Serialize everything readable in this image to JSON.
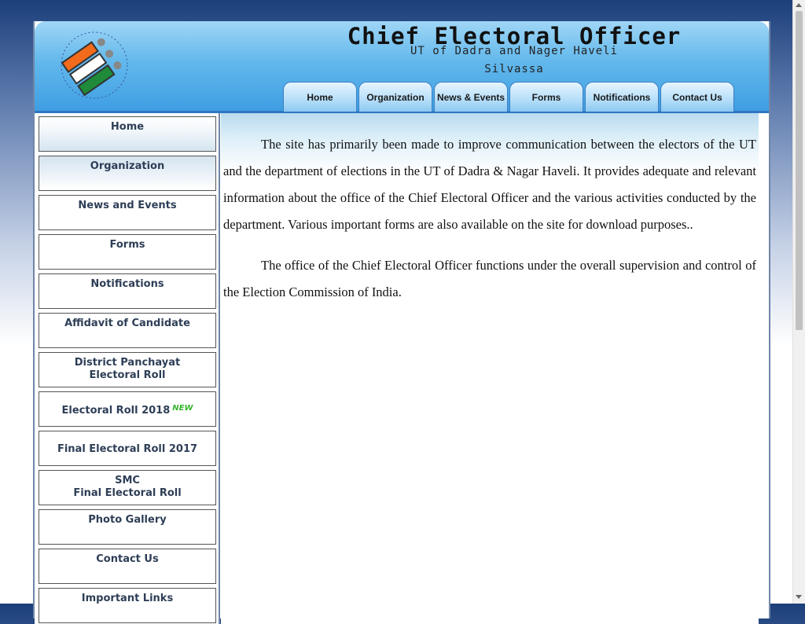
{
  "header": {
    "title": "Chief Electoral Officer",
    "subtitle": "UT of Dadra and Nager Haveli",
    "location": "Silvassa",
    "logo_icon": "ballot-finger-logo"
  },
  "top_nav": [
    {
      "label": "Home"
    },
    {
      "label": "Organization"
    },
    {
      "label": "News & Events"
    },
    {
      "label": "Forms"
    },
    {
      "label": "Notifications"
    },
    {
      "label": "Contact Us"
    }
  ],
  "sidebar": [
    {
      "label": "Home",
      "label2": ""
    },
    {
      "label": "Organization",
      "label2": ""
    },
    {
      "label": "News and Events",
      "label2": ""
    },
    {
      "label": "Forms",
      "label2": ""
    },
    {
      "label": "Notifications",
      "label2": ""
    },
    {
      "label": "Affidavit of Candidate",
      "label2": ""
    },
    {
      "label": "District Panchayat",
      "label2": "Electoral Roll"
    },
    {
      "label": "Electoral Roll 2018",
      "label2": "",
      "badge": "NEW"
    },
    {
      "label": "Final Electoral Roll 2017",
      "label2": ""
    },
    {
      "label": "SMC",
      "label2": "Final Electoral Roll"
    },
    {
      "label": "Photo Gallery",
      "label2": ""
    },
    {
      "label": "Contact Us",
      "label2": ""
    },
    {
      "label": "Important Links",
      "label2": ""
    }
  ],
  "content": {
    "paragraph1": "The site has primarily been made to improve communication between the electors of the UT and the department of elections in the UT of Dadra & Nagar Haveli. It provides adequate and relevant information about the office of the Chief Electoral Officer and the various activities conducted by the department. Various important forms are also available on the site for download purposes..",
    "paragraph2": "The office of the Chief Electoral Officer functions under the overall supervision and control of the Election Commission of India."
  },
  "colors": {
    "header_blue": "#3f9ee2",
    "sidebar_text": "#2e3e57",
    "new_badge": "#37b52e"
  }
}
